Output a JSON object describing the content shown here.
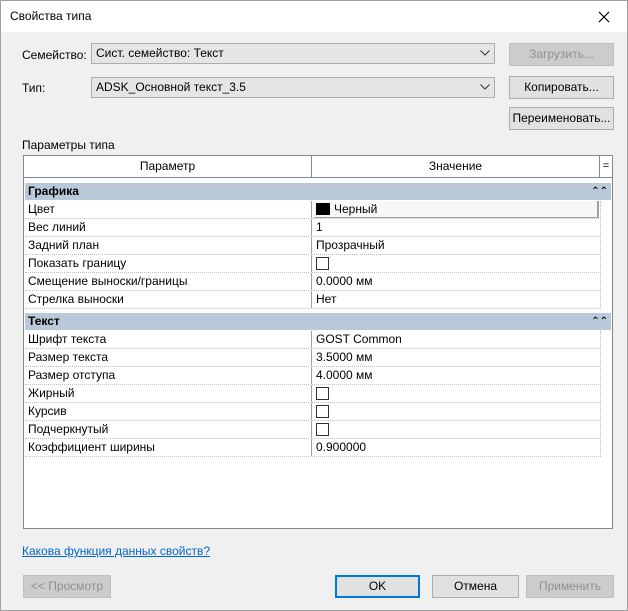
{
  "window": {
    "title": "Свойства типа"
  },
  "family": {
    "label": "Семейство:",
    "value": "Сист. семейство: Текст",
    "load_button": "Загрузить..."
  },
  "type": {
    "label": "Тип:",
    "value": "ADSK_Основной текст_3.5",
    "duplicate_button": "Копировать...",
    "rename_button": "Переименовать..."
  },
  "section_label": "Параметры типа",
  "grid": {
    "headers": {
      "param": "Параметр",
      "value": "Значение",
      "equals": "="
    },
    "groups": [
      {
        "name": "Графика",
        "rows": [
          {
            "param": "Цвет",
            "value": "Черный",
            "kind": "color",
            "color": "#000000"
          },
          {
            "param": "Вес линий",
            "value": "1",
            "kind": "text"
          },
          {
            "param": "Задний план",
            "value": "Прозрачный",
            "kind": "text"
          },
          {
            "param": "Показать границу",
            "value": "",
            "kind": "checkbox",
            "checked": false
          },
          {
            "param": "Смещение выноски/границы",
            "value": "0.0000 мм",
            "kind": "text"
          },
          {
            "param": "Стрелка выноски",
            "value": "Нет",
            "kind": "text"
          }
        ]
      },
      {
        "name": "Текст",
        "rows": [
          {
            "param": "Шрифт текста",
            "value": "GOST Common",
            "kind": "text"
          },
          {
            "param": "Размер текста",
            "value": "3.5000 мм",
            "kind": "text"
          },
          {
            "param": "Размер отступа",
            "value": "4.0000 мм",
            "kind": "text"
          },
          {
            "param": "Жирный",
            "value": "",
            "kind": "checkbox",
            "checked": false
          },
          {
            "param": "Курсив",
            "value": "",
            "kind": "checkbox",
            "checked": false
          },
          {
            "param": "Подчеркнутый",
            "value": "",
            "kind": "checkbox",
            "checked": false
          },
          {
            "param": "Коэффициент ширины",
            "value": "0.900000",
            "kind": "text"
          }
        ]
      }
    ]
  },
  "help_link": "Какова функция данных свойств?",
  "footer": {
    "preview_button": "<< Просмотр",
    "ok_button": "OK",
    "cancel_button": "Отмена",
    "apply_button": "Применить"
  },
  "colors": {
    "group_header_bg": "#b9c9da",
    "link": "#0066cc",
    "focus_border": "#0078d7"
  }
}
